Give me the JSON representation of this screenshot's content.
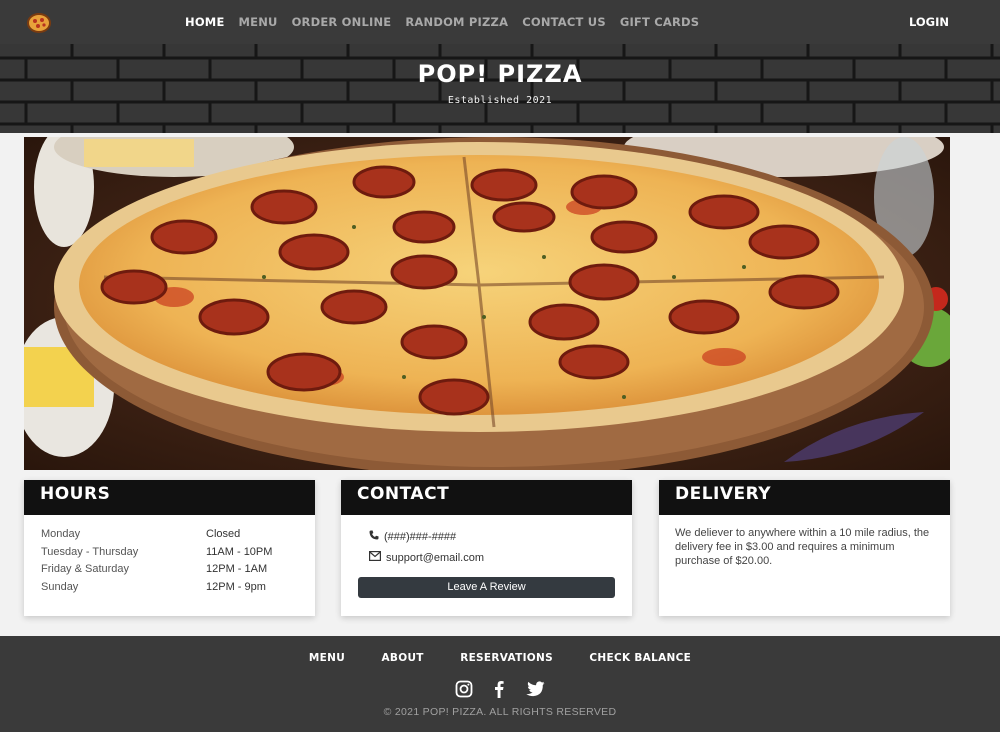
{
  "nav": {
    "links": [
      {
        "label": "HOME",
        "active": true
      },
      {
        "label": "MENU"
      },
      {
        "label": "ORDER ONLINE"
      },
      {
        "label": "RANDOM PIZZA"
      },
      {
        "label": "CONTACT US"
      },
      {
        "label": "GIFT CARDS"
      }
    ],
    "login": "LOGIN",
    "logo_icon": "pizza-icon"
  },
  "banner": {
    "title": "POP! PIZZA",
    "subtitle": "Established 2021"
  },
  "hours": {
    "title": "HOURS",
    "rows": [
      {
        "day": "Monday",
        "time": "Closed"
      },
      {
        "day": "Tuesday - Thursday",
        "time": "11AM - 10PM"
      },
      {
        "day": "Friday & Saturday",
        "time": "12PM - 1AM"
      },
      {
        "day": "Sunday",
        "time": "12PM - 9pm"
      }
    ]
  },
  "contact": {
    "title": "CONTACT",
    "phone": "(###)###-####",
    "email": "support@email.com",
    "review_button": "Leave A Review",
    "phone_icon": "phone-icon",
    "email_icon": "envelope-icon"
  },
  "delivery": {
    "title": "DELIVERY",
    "text": "We deliever to anywhere within a 10 mile radius, the delivery fee in $3.00 and requires a minimum purchase of $20.00."
  },
  "footer": {
    "links": [
      "MENU",
      "ABOUT",
      "RESERVATIONS",
      "CHECK BALANCE"
    ],
    "social": [
      "instagram-icon",
      "facebook-icon",
      "twitter-icon"
    ],
    "copyright": "© 2021 POP! PIZZA. ALL RIGHTS RESERVED"
  },
  "colors": {
    "nav_bg": "#3a3a3a",
    "card_header": "#111111",
    "button": "#343a40"
  }
}
